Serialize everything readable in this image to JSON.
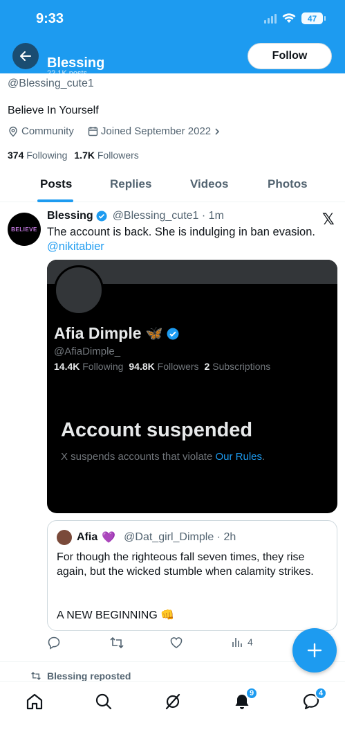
{
  "status_bar": {
    "time": "9:33",
    "battery": "47"
  },
  "header": {
    "name": "Blessing",
    "subtitle": "22.1K posts",
    "follow_label": "Follow"
  },
  "profile": {
    "handle": "@Blessing_cute1",
    "bio": "Believe In Yourself",
    "category": "Community",
    "joined": "Joined September 2022",
    "following_count": "374",
    "following_label": "Following",
    "followers_count": "1.7K",
    "followers_label": "Followers"
  },
  "tabs": [
    "Posts",
    "Replies",
    "Videos",
    "Photos"
  ],
  "tweet": {
    "avatar_text": "BELIEVE",
    "name": "Blessing",
    "handle_time": "@Blessing_cute1 · 1m",
    "text": "The account is back. She is indulging in ban evasion.",
    "mention": "@nikitabier",
    "media": {
      "name": "Afia Dimple",
      "name_emoji": "🦋",
      "handle": "@AfiaDimple_",
      "following_count": "14.4K",
      "following_label": "Following",
      "followers_count": "94.8K",
      "followers_label": "Followers",
      "subs_count": "2",
      "subs_label": "Subscriptions",
      "title": "Account suspended",
      "desc": "X suspends accounts that violate ",
      "desc_link": "Our Rules",
      "desc_end": "."
    },
    "quote": {
      "name": "Afia",
      "emoji": "💜",
      "handle_time": "@Dat_girl_Dimple · 2h",
      "text": "For though the righteous fall seven times, they rise again, but the wicked stumble when calamity strikes.",
      "text2": "A NEW BEGINNING 👊"
    },
    "views": "4"
  },
  "reposted_label": "Blessing reposted",
  "nav": {
    "notifications_badge": "9",
    "messages_badge": "4"
  },
  "colors": {
    "accent": "#1d9bf0",
    "text": "#0f1419",
    "muted": "#536471"
  }
}
